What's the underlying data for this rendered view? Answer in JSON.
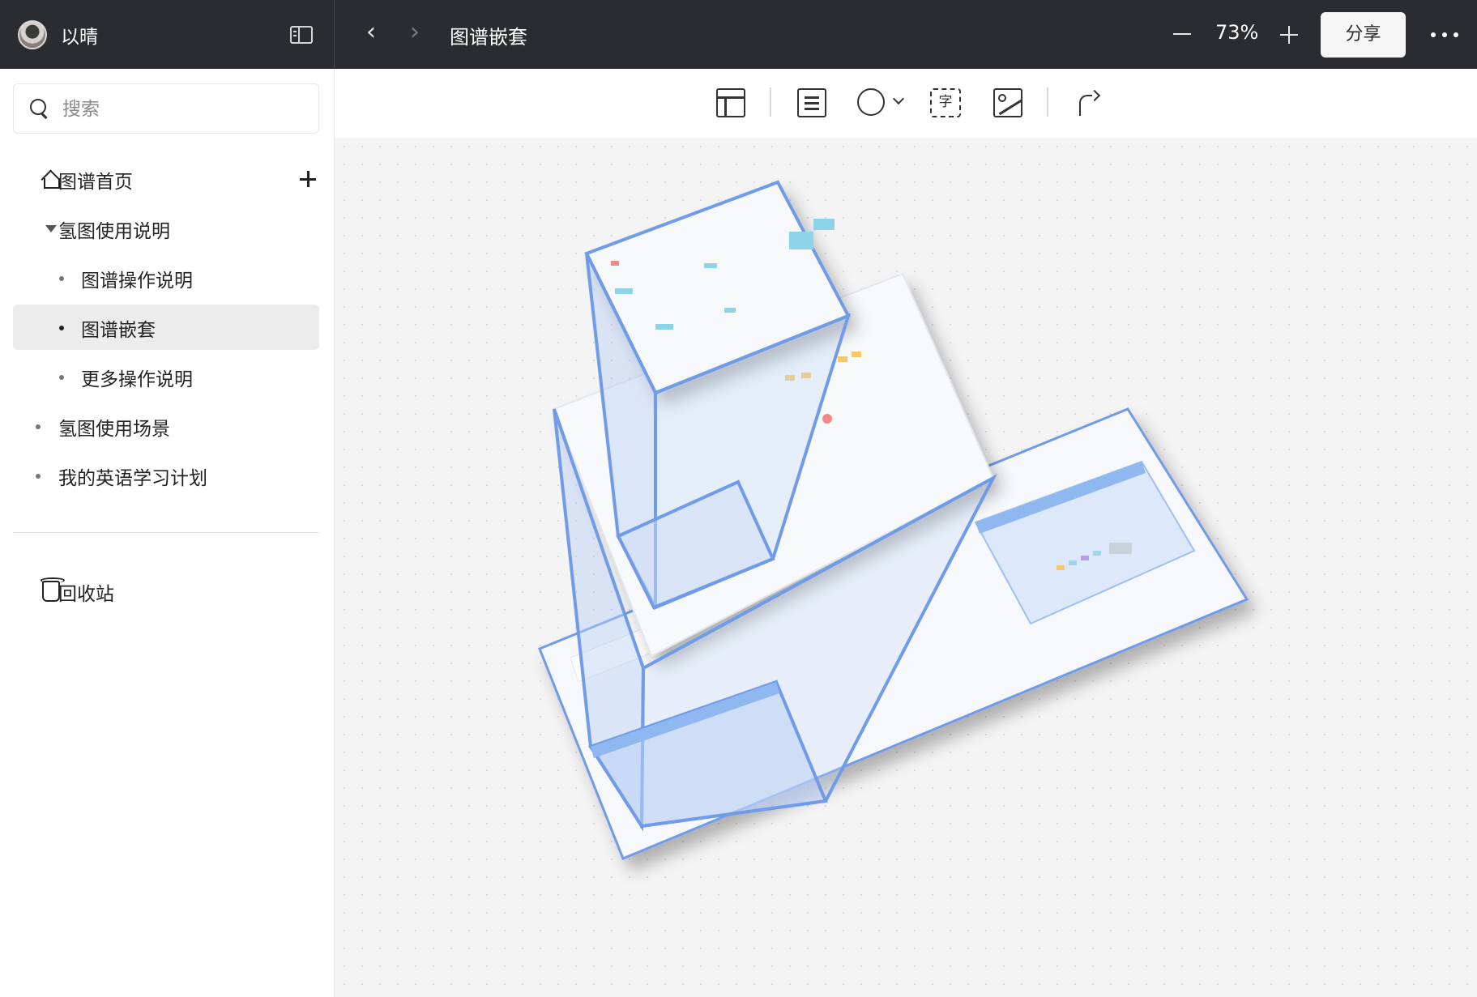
{
  "user": {
    "name": "以晴"
  },
  "header": {
    "title": "图谱嵌套",
    "zoom": "73%",
    "share_label": "分享"
  },
  "search": {
    "placeholder": "搜索"
  },
  "sidebar": {
    "home": "图谱首页",
    "items": [
      {
        "label": "氢图使用说明",
        "level": 0,
        "expanded": true
      },
      {
        "label": "图谱操作说明",
        "level": 1
      },
      {
        "label": "图谱嵌套",
        "level": 1,
        "active": true
      },
      {
        "label": "更多操作说明",
        "level": 1
      },
      {
        "label": "氢图使用场景",
        "level": 0
      },
      {
        "label": "我的英语学习计划",
        "level": 0
      }
    ],
    "trash": "回收站"
  },
  "toolbar": {
    "text_tool_glyph": "字"
  },
  "colors": {
    "topbar": "#2b2c30",
    "accent_blue": "#6f9be8",
    "canvas_bg": "#f4f4f5",
    "active_item": "#ececec"
  },
  "icons": [
    "search-icon",
    "home-icon",
    "add-icon",
    "caret-down-icon",
    "trash-icon",
    "frame-icon",
    "note-icon",
    "shape-icon",
    "text-icon",
    "image-icon",
    "connector-icon"
  ]
}
